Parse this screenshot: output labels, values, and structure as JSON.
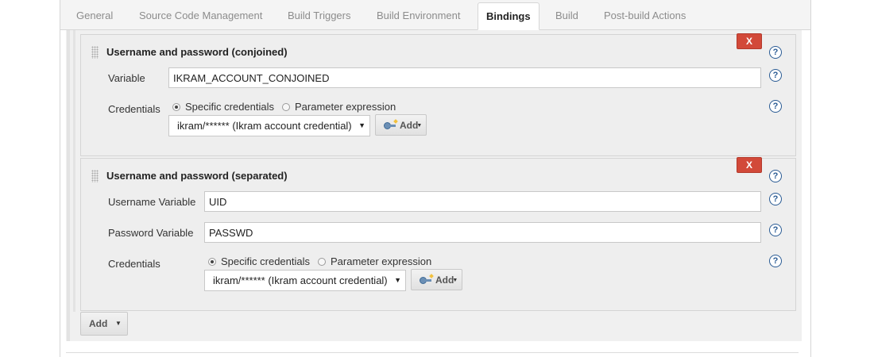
{
  "tabs": [
    {
      "label": "General"
    },
    {
      "label": "Source Code Management"
    },
    {
      "label": "Build Triggers"
    },
    {
      "label": "Build Environment"
    },
    {
      "label": "Bindings"
    },
    {
      "label": "Build"
    },
    {
      "label": "Post-build Actions"
    }
  ],
  "active_tab": "Bindings",
  "bindings": [
    {
      "title": "Username and password (conjoined)",
      "delete_label": "X",
      "variable_label": "Variable",
      "variable_value": "IKRAM_ACCOUNT_CONJOINED",
      "credentials_label": "Credentials",
      "radio_specific": "Specific credentials",
      "radio_parameter": "Parameter expression",
      "credential_selected": "ikram/****** (Ikram account credential)",
      "add_label": "Add"
    },
    {
      "title": "Username and password (separated)",
      "delete_label": "X",
      "username_label": "Username Variable",
      "username_value": "UID",
      "password_label": "Password Variable",
      "password_value": "PASSWD",
      "credentials_label": "Credentials",
      "radio_specific": "Specific credentials",
      "radio_parameter": "Parameter expression",
      "credential_selected": "ikram/****** (Ikram account credential)",
      "add_label": "Add"
    }
  ],
  "add_binding_label": "Add",
  "help_glyph": "?",
  "icons": {
    "help": "help-icon",
    "key": "key-icon",
    "drag": "drag-handle-icon",
    "dropdown": "chevron-down-icon"
  },
  "colors": {
    "delete_button": "#d24939",
    "help_icon": "#2a5b94",
    "section_bg": "#eeeeee"
  }
}
